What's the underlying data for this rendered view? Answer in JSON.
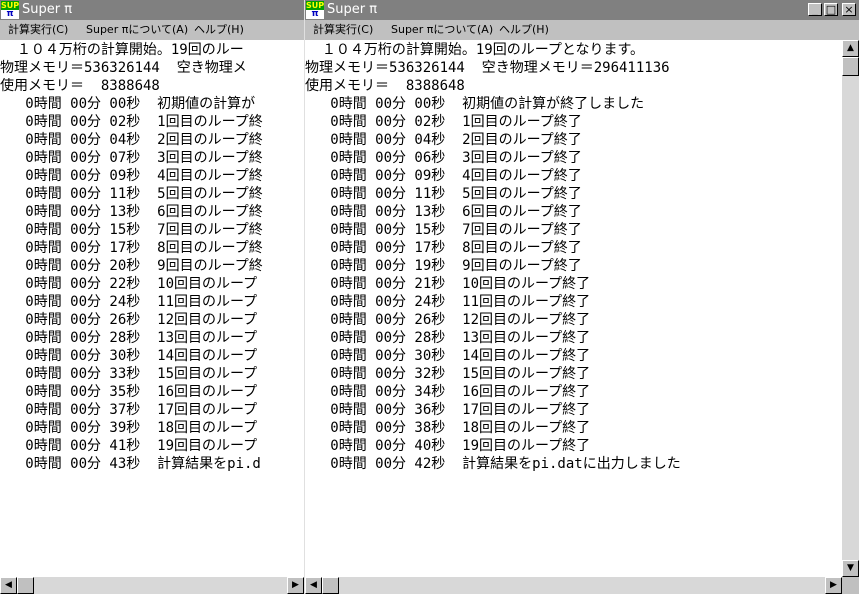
{
  "left_window": {
    "title": "Super π",
    "menu": [
      "計算実行(C)",
      "Super πについて(A)",
      "ヘルプ(H)"
    ],
    "lines": [
      "  １０４万桁の計算開始。19回のルー",
      "物理メモリ＝536326144  空き物理メ",
      "使用メモリ＝  8388648",
      "   0時間 00分 00秒  初期値の計算が",
      "   0時間 00分 02秒  1回目のループ終",
      "   0時間 00分 04秒  2回目のループ終",
      "   0時間 00分 07秒  3回目のループ終",
      "   0時間 00分 09秒  4回目のループ終",
      "   0時間 00分 11秒  5回目のループ終",
      "   0時間 00分 13秒  6回目のループ終",
      "   0時間 00分 15秒  7回目のループ終",
      "   0時間 00分 17秒  8回目のループ終",
      "   0時間 00分 20秒  9回目のループ終",
      "   0時間 00分 22秒  10回目のループ",
      "   0時間 00分 24秒  11回目のループ",
      "   0時間 00分 26秒  12回目のループ",
      "   0時間 00分 28秒  13回目のループ",
      "   0時間 00分 30秒  14回目のループ",
      "   0時間 00分 33秒  15回目のループ",
      "   0時間 00分 35秒  16回目のループ",
      "   0時間 00分 37秒  17回目のループ",
      "   0時間 00分 39秒  18回目のループ",
      "   0時間 00分 41秒  19回目のループ",
      "   0時間 00分 43秒  計算結果をpi.d"
    ]
  },
  "right_window": {
    "title": "Super π",
    "menu": [
      "計算実行(C)",
      "Super πについて(A)",
      "ヘルプ(H)"
    ],
    "controls": {
      "minimize": "_",
      "maximize": "□",
      "close": "×"
    },
    "lines": [
      "  １０４万桁の計算開始。19回のループとなります。",
      "物理メモリ＝536326144  空き物理メモリ＝296411136",
      "使用メモリ＝  8388648",
      "   0時間 00分 00秒  初期値の計算が終了しました",
      "   0時間 00分 02秒  1回目のループ終了",
      "   0時間 00分 04秒  2回目のループ終了",
      "   0時間 00分 06秒  3回目のループ終了",
      "   0時間 00分 09秒  4回目のループ終了",
      "   0時間 00分 11秒  5回目のループ終了",
      "   0時間 00分 13秒  6回目のループ終了",
      "   0時間 00分 15秒  7回目のループ終了",
      "   0時間 00分 17秒  8回目のループ終了",
      "   0時間 00分 19秒  9回目のループ終了",
      "   0時間 00分 21秒  10回目のループ終了",
      "   0時間 00分 24秒  11回目のループ終了",
      "   0時間 00分 26秒  12回目のループ終了",
      "   0時間 00分 28秒  13回目のループ終了",
      "   0時間 00分 30秒  14回目のループ終了",
      "   0時間 00分 32秒  15回目のループ終了",
      "   0時間 00分 34秒  16回目のループ終了",
      "   0時間 00分 36秒  17回目のループ終了",
      "   0時間 00分 38秒  18回目のループ終了",
      "   0時間 00分 40秒  19回目のループ終了",
      "   0時間 00分 42秒  計算結果をpi.datに出力しました"
    ]
  },
  "icons": {
    "app_icon": "super-pi-icon",
    "app_icon_text": "SUPER",
    "app_icon_glyph": "π",
    "scroll_up": "▲",
    "scroll_down": "▼",
    "scroll_left": "◀",
    "scroll_right": "▶"
  },
  "colors": {
    "inactive_titlebar": "#808080",
    "face": "#c0c0c0",
    "client": "#ffffff"
  }
}
